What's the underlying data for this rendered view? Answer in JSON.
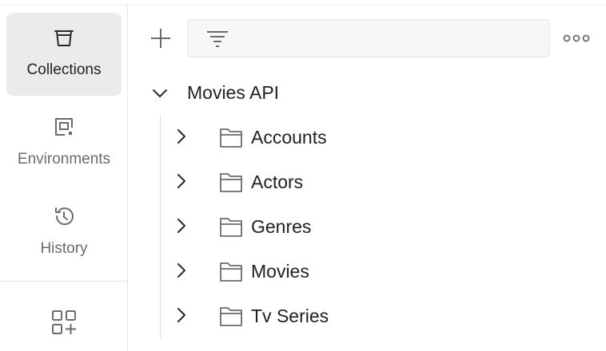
{
  "sidebar": {
    "items": [
      {
        "label": "Collections",
        "icon": "trash-bin-collections-icon",
        "active": true
      },
      {
        "label": "Environments",
        "icon": "environment-icon",
        "active": false
      },
      {
        "label": "History",
        "icon": "history-icon",
        "active": false
      }
    ],
    "apps_icon": "grid-plus-icon"
  },
  "toolbar": {
    "add_icon": "plus-icon",
    "filter_icon": "filter-icon",
    "search_value": "",
    "search_placeholder": "",
    "more_icon": "more-horizontal-icon"
  },
  "tree": {
    "collection": {
      "name": "Movies API",
      "expanded": true
    },
    "folders": [
      {
        "name": "Accounts"
      },
      {
        "name": "Actors"
      },
      {
        "name": "Genres"
      },
      {
        "name": "Movies"
      },
      {
        "name": "Tv Series"
      }
    ]
  },
  "colors": {
    "active_bg": "#ebebeb",
    "text": "#212121",
    "muted_text": "#6b6b6b",
    "icon": "#6b6b6b",
    "border": "#e6e6e6"
  }
}
